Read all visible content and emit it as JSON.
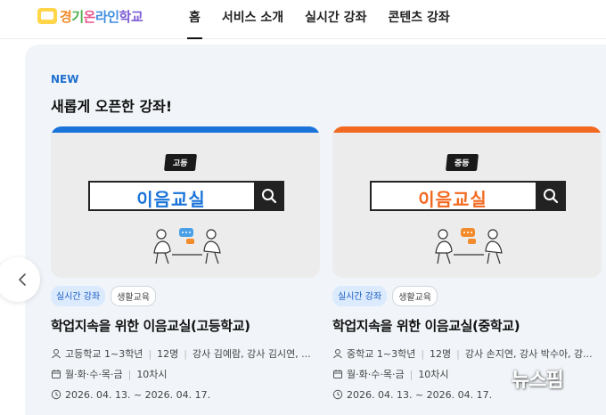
{
  "header": {
    "logo_chars": [
      "경",
      "기",
      "온",
      "라인",
      "학교"
    ],
    "nav": [
      "홈",
      "서비스 소개",
      "실시간 강좌",
      "콘텐츠 강좌"
    ]
  },
  "section": {
    "new_label": "NEW",
    "title": "새롭게 오픈한 강좌!"
  },
  "cards": [
    {
      "accent": "#1a73d9",
      "level_badge": "고등",
      "search_word": "이음교실",
      "tags": [
        "실시간 강좌",
        "생활교육"
      ],
      "title": "학업지속을 위한 이음교실(고등학교)",
      "grade": "고등학교 1~3학년",
      "capacity": "12명",
      "teachers": "강사 김예람, 강사 김시연, ...",
      "days": "월·화·수·목·금",
      "sessions": "10차시",
      "period": "2026. 04. 13. ~ 2026. 04. 17."
    },
    {
      "accent": "#f26a21",
      "level_badge": "중등",
      "search_word": "이음교실",
      "tags": [
        "실시간 강좌",
        "생활교육"
      ],
      "title": "학업지속을 위한 이음교실(중학교)",
      "grade": "중학교 1~3학년",
      "capacity": "12명",
      "teachers": "강사 손지연, 강사 박수아, 강...",
      "days": "월·화·수·목·금",
      "sessions": "10차시",
      "period": "2026. 04. 13. ~ 2026. 04. 17."
    }
  ],
  "watermark": "뉴스핌",
  "icons": [
    "chevron-left-icon",
    "search-icon",
    "user-icon",
    "calendar-icon",
    "clock-icon"
  ]
}
